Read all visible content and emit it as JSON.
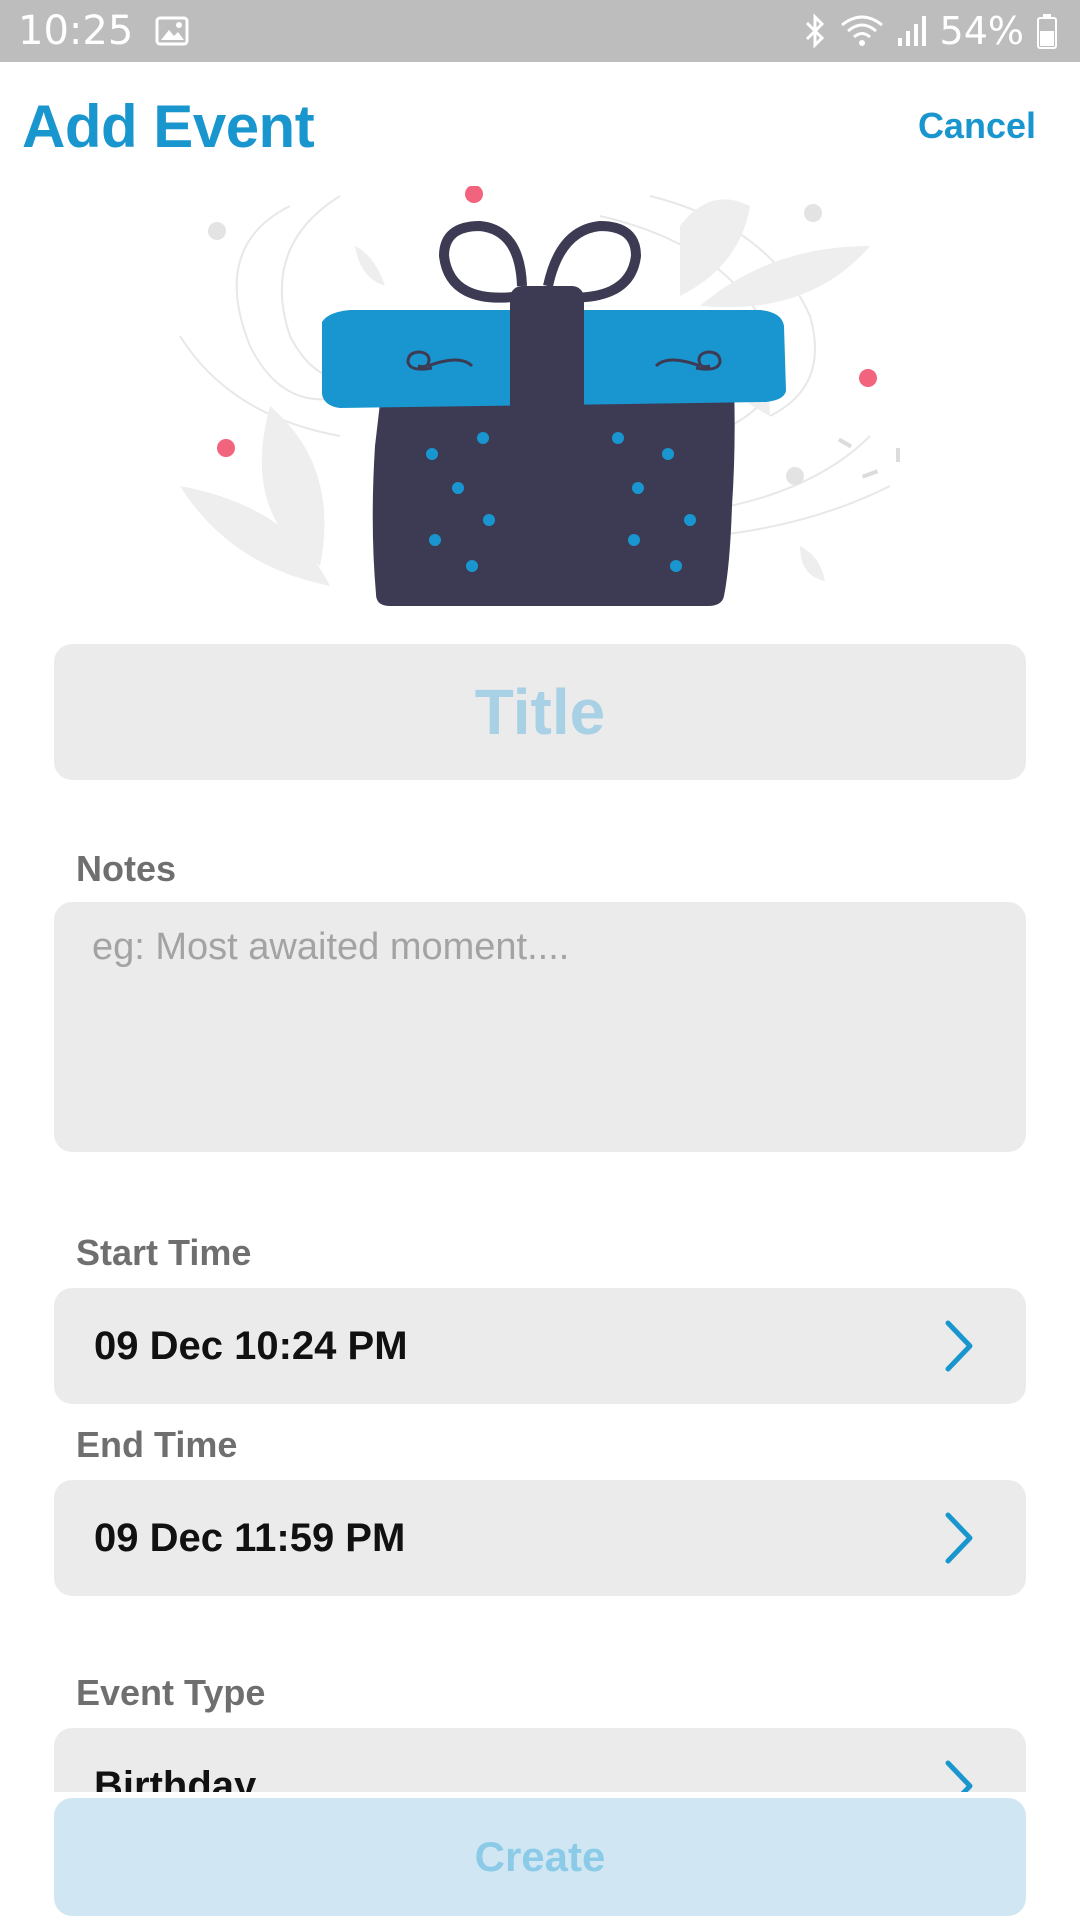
{
  "status_bar": {
    "time": "10:25",
    "battery": "54%",
    "icons": [
      "image-icon",
      "bluetooth-icon",
      "wifi-icon",
      "signal-icon",
      "battery-icon"
    ]
  },
  "header": {
    "title": "Add Event",
    "cancel_label": "Cancel"
  },
  "form": {
    "title_placeholder": "Title",
    "notes_label": "Notes",
    "notes_placeholder": "eg: Most awaited moment....",
    "start_time_label": "Start Time",
    "start_time_value": "09 Dec 10:24 PM",
    "end_time_label": "End Time",
    "end_time_value": "09 Dec 11:59 PM",
    "event_type_label": "Event Type",
    "event_type_value": "Birthday"
  },
  "actions": {
    "create_label": "Create"
  },
  "colors": {
    "accent": "#1a96cf",
    "gift_body": "#3d3b54",
    "gift_lid": "#1996cf",
    "dot_pink": "#f2637e",
    "field_bg": "#ebebeb",
    "button_disabled_bg": "#d0e7f3"
  }
}
